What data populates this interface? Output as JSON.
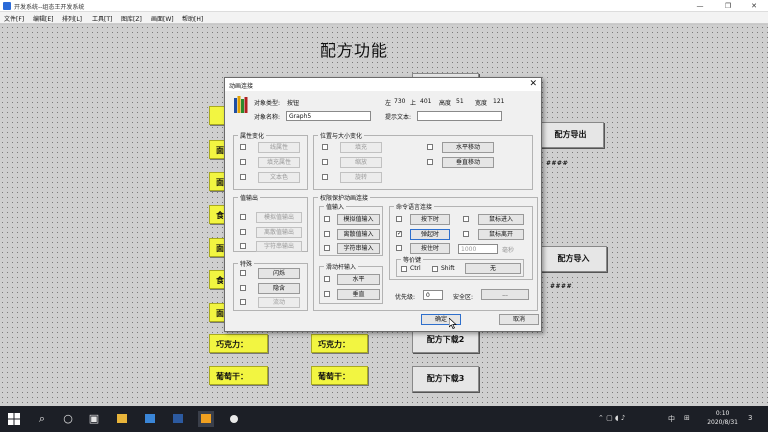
{
  "window": {
    "title": "开发系统--组态王开发系统",
    "minimize": "—",
    "restore": "❐",
    "close": "✕"
  },
  "menu": [
    "文件[F]",
    "编辑[E]",
    "排列[L]",
    "工具[T]",
    "图库[Z]",
    "画面[W]",
    "帮助[H]"
  ],
  "canvas": {
    "page_title": "配方功能",
    "yellow_buttons": [
      "巧克力：",
      "葡萄干：",
      "巧克力：",
      "葡萄干："
    ],
    "gray_buttons": {
      "export": "配方导出",
      "import": "配方导入",
      "download2": "配方下载2",
      "download3": "配方下载3"
    },
    "hash_marks": [
      "####",
      "####"
    ],
    "yellow_fragments": [
      "面",
      "面",
      "食",
      "面",
      "食",
      "面",
      "食"
    ]
  },
  "dialog": {
    "title": "动画连接",
    "close": "✕",
    "object_type_label": "对象类型:",
    "object_type_value": "按钮",
    "object_name_label": "对象名称:",
    "object_name_value": "Graph5",
    "left_label": "左",
    "left_value": "730",
    "top_label": "上",
    "top_value": "401",
    "height_label": "高度",
    "height_value": "51",
    "width_label": "宽度",
    "width_value": "121",
    "tip_label": "提示文本:",
    "tip_value": "",
    "groups": {
      "attr": {
        "label": "属性变化",
        "buttons": [
          "线属性",
          "填充属性",
          "文本色"
        ]
      },
      "possize": {
        "label": "位置与大小变化",
        "buttons": [
          "填充",
          "缩放",
          "旋转"
        ],
        "move_buttons": [
          "水平移动",
          "垂直移动"
        ]
      },
      "valout": {
        "label": "值输出",
        "buttons": [
          "模拟值输出",
          "离散值输出",
          "字符串输出"
        ]
      },
      "special": {
        "label": "特殊",
        "buttons": [
          "闪烁",
          "隐含",
          "流动"
        ]
      },
      "perm": {
        "label": "权限保护动画连接"
      },
      "valin": {
        "label": "值输入",
        "buttons": [
          "模拟值输入",
          "离散值输入",
          "字符串输入"
        ]
      },
      "slider": {
        "label": "滑动杆输入",
        "buttons": [
          "水平",
          "垂直"
        ]
      },
      "cmd": {
        "label": "命令语言连接",
        "buttons": [
          "按下时",
          "弹起时",
          "按住时"
        ],
        "mouse_buttons": [
          "鼠标进入",
          "鼠标离开"
        ],
        "interval": "1000",
        "ms": "毫秒"
      },
      "hotkey": {
        "label": "等价键",
        "ctrl": "Ctrl",
        "shift": "Shift",
        "none": "无"
      }
    },
    "priority_label": "优先级:",
    "priority_value": "0",
    "security_label": "安全区:",
    "security_button": "...",
    "ok": "确定",
    "cancel": "取消"
  },
  "taskbar": {
    "time": "0:10",
    "date": "2020/8/31",
    "lang": "中",
    "notify": "3"
  }
}
